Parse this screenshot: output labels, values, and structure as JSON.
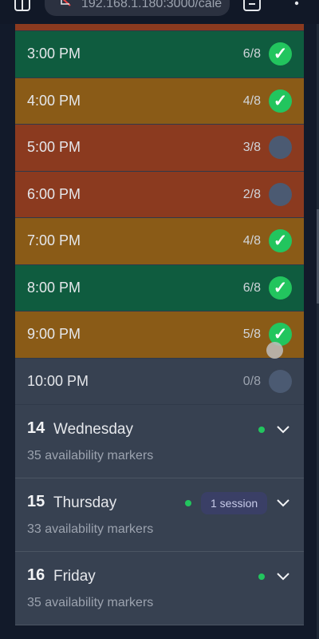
{
  "browser": {
    "url": "192.168.1.180:3000/cale"
  },
  "slots": [
    {
      "time": "3:00 PM",
      "count": "6/8",
      "status": "green",
      "checked": true
    },
    {
      "time": "4:00 PM",
      "count": "4/8",
      "status": "amber",
      "checked": true
    },
    {
      "time": "5:00 PM",
      "count": "3/8",
      "status": "red",
      "checked": false
    },
    {
      "time": "6:00 PM",
      "count": "2/8",
      "status": "red",
      "checked": false
    },
    {
      "time": "7:00 PM",
      "count": "4/8",
      "status": "amber",
      "checked": true
    },
    {
      "time": "8:00 PM",
      "count": "6/8",
      "status": "green",
      "checked": true
    },
    {
      "time": "9:00 PM",
      "count": "5/8",
      "status": "amber",
      "checked": true
    },
    {
      "time": "10:00 PM",
      "count": "0/8",
      "status": "gray",
      "checked": false
    }
  ],
  "check_glyph": "✓",
  "days": [
    {
      "num": "14",
      "name": "Wednesday",
      "markers": "35 availability markers",
      "badge": ""
    },
    {
      "num": "15",
      "name": "Thursday",
      "markers": "33 availability markers",
      "badge": "1 session"
    },
    {
      "num": "16",
      "name": "Friday",
      "markers": "35 availability markers",
      "badge": ""
    }
  ],
  "colors": {
    "green": "#0f5c3f",
    "amber": "#8a5b17",
    "red": "#8b3a1f",
    "gray": "#374151",
    "check": "#22c55e"
  }
}
